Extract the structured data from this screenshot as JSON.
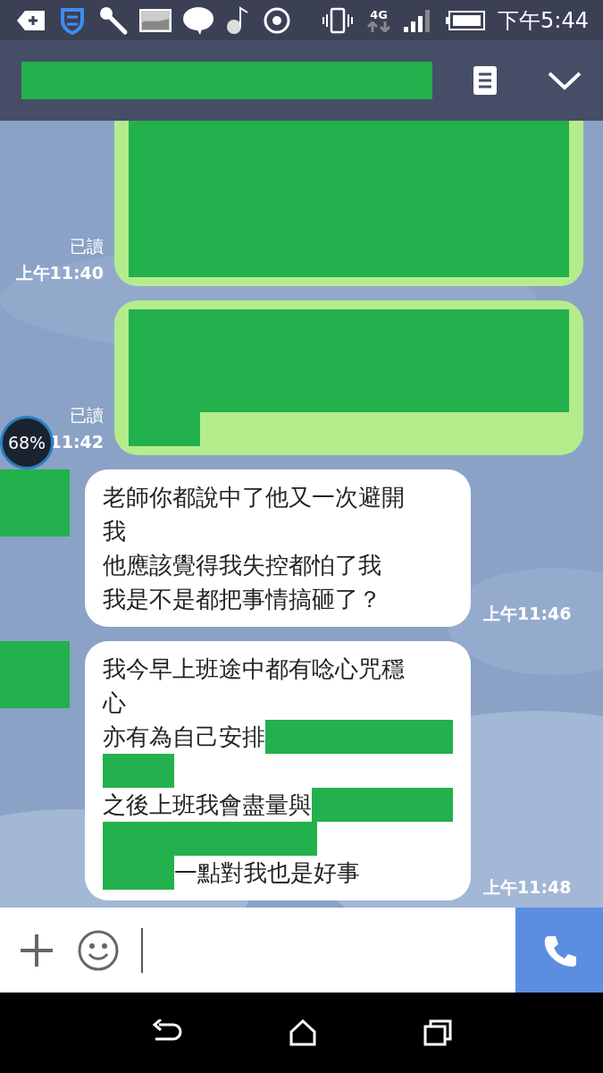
{
  "status_bar": {
    "network": "4G",
    "time": "下午5:44"
  },
  "header": {
    "title_redacted": true
  },
  "overlay_widget": {
    "text": "68%"
  },
  "messages": [
    {
      "kind": "sent",
      "read": "已讀",
      "time": "上午11:40",
      "lines": [
        [
          {
            "kind": "redacted_block"
          }
        ],
        [
          {
            "kind": "redacted_block"
          }
        ]
      ]
    },
    {
      "kind": "sent",
      "read": "已讀",
      "time": "11:42",
      "lines": [
        [
          {
            "kind": "redacted_block"
          }
        ],
        [
          {
            "kind": "redacted"
          }
        ]
      ]
    },
    {
      "kind": "received",
      "avatar_redacted": true,
      "time": "上午11:46",
      "lines": [
        [
          {
            "kind": "text",
            "text": "老師你都說中了他又一次避開"
          }
        ],
        [
          {
            "kind": "text",
            "text": "我"
          }
        ],
        [
          {
            "kind": "text",
            "text": "他應該覺得我失控都怕了我"
          }
        ],
        [
          {
            "kind": "text",
            "text": "我是不是都把事情搞砸了？"
          }
        ]
      ]
    },
    {
      "kind": "received",
      "avatar_redacted": true,
      "time": "上午11:48",
      "lines": [
        [
          {
            "kind": "text",
            "text": "我今早上班途中都有唸心咒穩"
          }
        ],
        [
          {
            "kind": "text",
            "text": "心"
          }
        ],
        [
          {
            "kind": "text",
            "text": "亦有為自己安排"
          },
          {
            "kind": "redacted_fill"
          }
        ],
        [
          {
            "kind": "redacted"
          }
        ],
        [
          {
            "kind": "text",
            "text": "之後上班我會盡量與"
          },
          {
            "kind": "redacted_fill"
          }
        ],
        [
          {
            "kind": "redacted_long"
          }
        ],
        [
          {
            "kind": "redacted"
          },
          {
            "kind": "text",
            "text": "一點對我也是好事"
          }
        ]
      ]
    }
  ]
}
